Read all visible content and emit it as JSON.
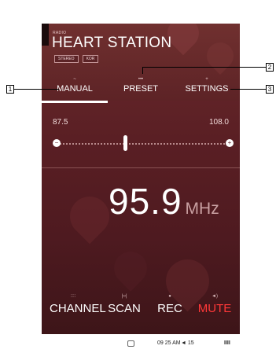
{
  "header": {
    "label": "RADIO",
    "title": "HEART STATION",
    "badges": [
      "STEREO",
      "KOR"
    ]
  },
  "tabs": [
    {
      "label": "MANUAL",
      "glyph": "~",
      "active": true
    },
    {
      "label": "PRESET",
      "glyph": "•••",
      "active": false
    },
    {
      "label": "SETTINGS",
      "glyph": "+",
      "active": false
    }
  ],
  "tuner": {
    "min": "87.5",
    "max": "108.0",
    "current": "95.9",
    "unit": "MHz",
    "level": 0.41,
    "min_button": "−",
    "max_button": "+"
  },
  "controls": [
    {
      "label": "CHANNEL",
      "glyph": "::::"
    },
    {
      "label": "SCAN",
      "glyph": "|‹›|"
    },
    {
      "label": "REC",
      "glyph": "●"
    },
    {
      "label": "MUTE",
      "glyph": "◄)"
    }
  ],
  "statusbar": {
    "time": "09 25 AM",
    "volume": "◄ 15",
    "signal": "IIII"
  },
  "callouts": [
    "1",
    "2",
    "3"
  ],
  "colors": {
    "background": "#5a1f24",
    "accent_mute": "#ff3838",
    "text": "#ffffff"
  },
  "icons": {
    "battery": "battery-icon",
    "volume": "speaker-icon",
    "signal": "signal-bars-icon"
  }
}
